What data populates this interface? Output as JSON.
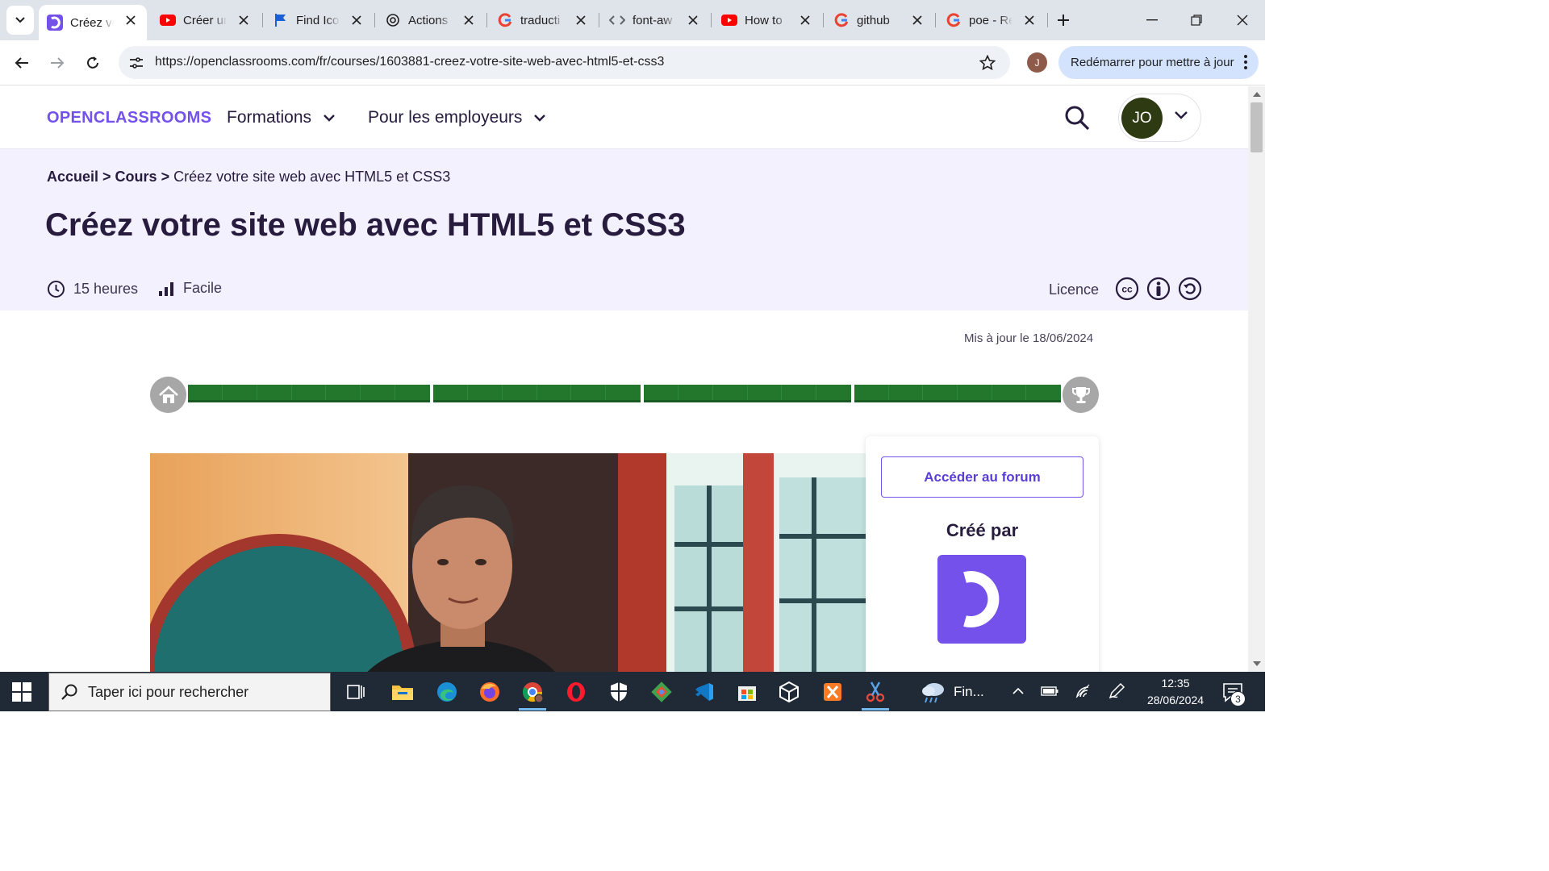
{
  "browser": {
    "tabs": [
      {
        "label": "Créez vo",
        "icon": "openclassrooms-icon",
        "active": true
      },
      {
        "label": "Créer un",
        "icon": "youtube-icon"
      },
      {
        "label": "Find Ico",
        "icon": "flag-icon"
      },
      {
        "label": "Actions",
        "icon": "openai-icon"
      },
      {
        "label": "traducti",
        "icon": "google-icon"
      },
      {
        "label": "font-aw",
        "icon": "code-icon"
      },
      {
        "label": "How to",
        "icon": "youtube-icon"
      },
      {
        "label": "github",
        "icon": "google-icon"
      },
      {
        "label": "poe - Re",
        "icon": "google-icon"
      }
    ],
    "url": "https://openclassrooms.com/fr/courses/1603881-creez-votre-site-web-avec-html5-et-css3",
    "profile_initial": "J",
    "restart_label": "Redémarrer pour mettre à jour"
  },
  "site": {
    "logo": "OPENCLASSROOMS",
    "nav": {
      "formations": "Formations",
      "employers": "Pour les employeurs"
    },
    "user_initials": "JO"
  },
  "course": {
    "breadcrumb": {
      "home": "Accueil",
      "sep1": " > ",
      "courses": "Cours",
      "sep2": " > ",
      "current": "Créez votre site web avec HTML5 et CSS3"
    },
    "title": "Créez votre site web avec HTML5 et CSS3",
    "duration": "15 heures",
    "difficulty": "Facile",
    "licence_label": "Licence",
    "licence_icons": [
      "cc-icon",
      "by-icon",
      "sa-icon"
    ],
    "updated": "Mis à jour le 18/06/2024",
    "progress": {
      "completed_fraction": 1.0,
      "parts": [
        {
          "chapters": 7
        },
        {
          "chapters": 6
        },
        {
          "chapters": 6
        },
        {
          "chapters": 6
        }
      ]
    },
    "forum_button": "Accéder au forum",
    "created_by": "Créé par"
  },
  "taskbar": {
    "search_placeholder": "Taper ici pour rechercher",
    "weather_label": "Fin...",
    "time": "12:35",
    "date": "28/06/2024",
    "notifications": "3"
  },
  "colors": {
    "brand_purple": "#7451eb",
    "progress_green": "#22772d",
    "hero_bg": "#f3f1fd",
    "taskbar_bg": "#1f2a36"
  }
}
